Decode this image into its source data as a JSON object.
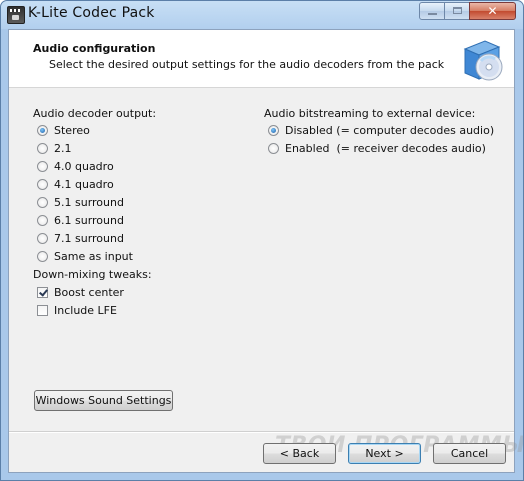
{
  "window": {
    "title": "K-Lite Codec Pack"
  },
  "header": {
    "title": "Audio configuration",
    "subtitle": "Select the desired output settings for the audio decoders from the pack"
  },
  "decoder_output": {
    "label": "Audio decoder output:",
    "options": [
      "Stereo",
      "2.1",
      "4.0 quadro",
      "4.1 quadro",
      "5.1 surround",
      "6.1 surround",
      "7.1 surround",
      "Same as input"
    ],
    "selected": "Stereo"
  },
  "downmix": {
    "label": "Down-mixing tweaks:",
    "options": [
      {
        "label": "Boost center",
        "checked": true
      },
      {
        "label": "Include LFE",
        "checked": false
      }
    ]
  },
  "bitstreaming": {
    "label": "Audio bitstreaming to external device:",
    "options": [
      "Disabled (= computer decodes audio)",
      "Enabled  (= receiver decodes audio)"
    ],
    "selected": "Disabled (= computer decodes audio)"
  },
  "buttons": {
    "sound_settings": "Windows Sound Settings",
    "back": "< Back",
    "next": "Next >",
    "cancel": "Cancel"
  },
  "watermark": "ТВОИ ПРОГРАММЫ РУ",
  "colors": {
    "accent": "#1c5fa8",
    "title_bar": "#b2cfee"
  }
}
